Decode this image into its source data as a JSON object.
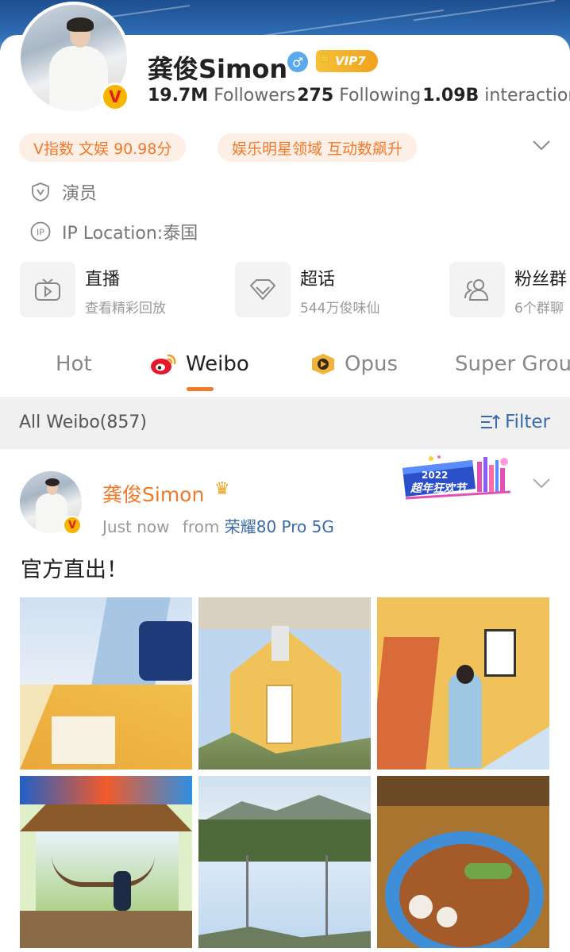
{
  "profile": {
    "name": "龚俊Simon",
    "vip_label": "VIP7",
    "followers_count": "19.7M",
    "followers_label": "Followers",
    "following_count": "275",
    "following_label": "Following",
    "interactions_count": "1.09B",
    "interactions_label": "interaction",
    "pill_1": "V指数 文娱 90.98分",
    "pill_2": "娱乐明星领域 互动数飙升",
    "occupation": "演员",
    "ip_location": "IP Location:泰国"
  },
  "features": [
    {
      "title": "直播",
      "subtitle": "查看精彩回放",
      "icon": "tv-icon"
    },
    {
      "title": "超话",
      "subtitle": "544万俊味仙",
      "icon": "diamond-icon"
    },
    {
      "title": "粉丝群",
      "subtitle": "6个群聊",
      "icon": "group-icon"
    }
  ],
  "tabs": [
    {
      "label": "Hot"
    },
    {
      "label": "Weibo",
      "active": true
    },
    {
      "label": "Opus"
    },
    {
      "label": "Super Grou"
    }
  ],
  "filter_bar": {
    "all_label": "All Weibo(857)",
    "filter_label": "Filter"
  },
  "post": {
    "author": "龚俊Simon",
    "time": "Just now",
    "from_label": "from",
    "device": "荣耀80 Pro 5G",
    "text": "官方直出！",
    "festival_year": "2022",
    "festival_text": "超年狂欢节"
  },
  "colors": {
    "accent": "#f07a2a",
    "link": "#3a6aa8",
    "vip_gold": "#f0a21e",
    "verified_badge": "#f7b500"
  }
}
